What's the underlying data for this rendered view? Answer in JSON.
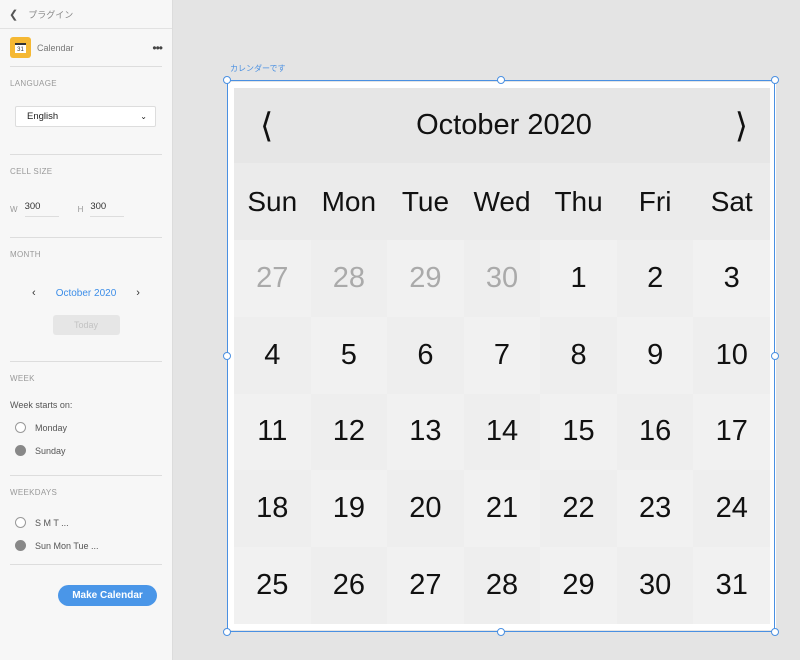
{
  "panel": {
    "back_label": "プラグイン",
    "plugin_name": "Calendar",
    "plugin_icon_text": "31",
    "language": {
      "title": "LANGUAGE",
      "selected": "English"
    },
    "cell_size": {
      "title": "CELL SIZE",
      "w_label": "W",
      "w_value": "300",
      "h_label": "H",
      "h_value": "300"
    },
    "month": {
      "title": "MONTH",
      "value": "October 2020",
      "today_label": "Today"
    },
    "week": {
      "title": "WEEK",
      "label": "Week starts on:",
      "options": [
        {
          "label": "Monday",
          "selected": false
        },
        {
          "label": "Sunday",
          "selected": true
        }
      ]
    },
    "weekdays": {
      "title": "WEEKDAYS",
      "options": [
        {
          "label": "S M T ...",
          "selected": false
        },
        {
          "label": "Sun Mon Tue ...",
          "selected": true
        }
      ]
    },
    "make_label": "Make Calendar"
  },
  "canvas": {
    "caption": "カレンダーです",
    "selection_color": "#4a90e2",
    "calendar": {
      "title": "October 2020",
      "weekdays": [
        "Sun",
        "Mon",
        "Tue",
        "Wed",
        "Thu",
        "Fri",
        "Sat"
      ],
      "prev_days": [
        "27",
        "28",
        "29",
        "30"
      ],
      "days": [
        "1",
        "2",
        "3",
        "4",
        "5",
        "6",
        "7",
        "8",
        "9",
        "10",
        "11",
        "12",
        "13",
        "14",
        "15",
        "16",
        "17",
        "18",
        "19",
        "20",
        "21",
        "22",
        "23",
        "24",
        "25",
        "26",
        "27",
        "28",
        "29",
        "30",
        "31"
      ]
    }
  }
}
